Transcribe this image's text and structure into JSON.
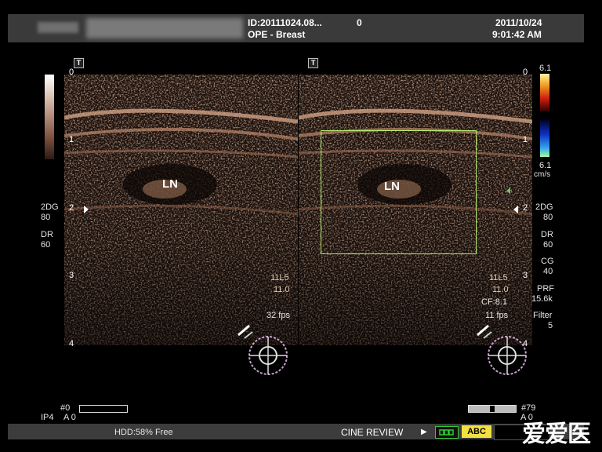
{
  "header": {
    "id_text": "ID:20111024.08...",
    "extra_char": "0",
    "scope_text": "OPE -   Breast",
    "date": "2011/10/24",
    "time": "9:01:42 AM"
  },
  "left_params": {
    "mode": "2DG",
    "gain": "80",
    "dr_label": "DR",
    "dr_value": "60"
  },
  "right_params": {
    "mode": "2DG",
    "gain": "80",
    "dr_label": "DR",
    "dr_value": "60",
    "cg_label": "CG",
    "cg_value": "40",
    "prf_label": "PRF",
    "prf_value": "15.6k",
    "filter_label": "Filter",
    "filter_value": "5"
  },
  "color_scale": {
    "top": "6.1",
    "bottom": "6.1",
    "unit": "cm/s"
  },
  "depth_left": [
    "0",
    "1",
    "2",
    "3",
    "4"
  ],
  "depth_right": [
    "0",
    "1",
    "2",
    "3",
    "4"
  ],
  "left_image": {
    "label": "LN",
    "probe": "11L5",
    "freq": "11.0",
    "fps": "32 fps"
  },
  "right_image": {
    "label": "LN",
    "probe": "11L5",
    "freq": "11.0",
    "cf": "CF:8.1",
    "fps": "11 fps"
  },
  "frame_left": {
    "num": "#0",
    "ip": "IP4",
    "a": "A 0"
  },
  "frame_right": {
    "num": "#79",
    "a": "A 0"
  },
  "bottom": {
    "hdd": "HDD:58% Free",
    "cine": "CINE REVIEW",
    "abc": "ABC",
    "watermark": "爱爱医"
  },
  "colors": {
    "tissue": "#c08a6a",
    "roi_box": "#b8f070",
    "abc_bg": "#f0e040"
  }
}
